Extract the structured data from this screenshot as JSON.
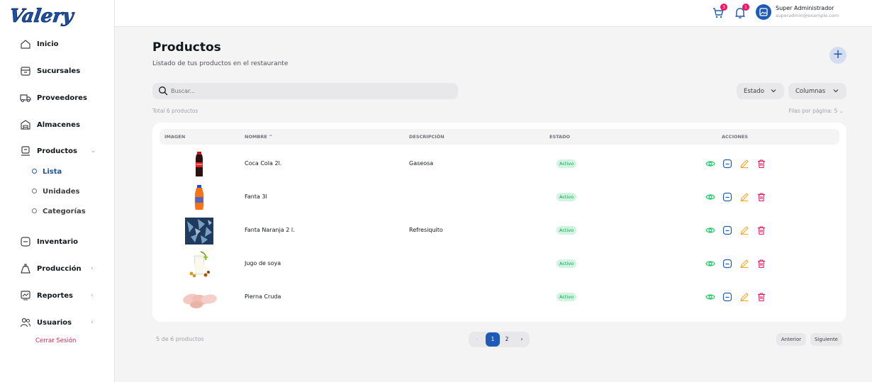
{
  "brand": {
    "logo_text": "Valery",
    "color": "#1e4fa0"
  },
  "sidebar": {
    "items": [
      {
        "label": "Inicio",
        "icon": "home-icon"
      },
      {
        "label": "Sucursales",
        "icon": "store-icon"
      },
      {
        "label": "Proveedores",
        "icon": "truck-icon"
      },
      {
        "label": "Almacenes",
        "icon": "warehouse-icon"
      },
      {
        "label": "Productos",
        "icon": "product-icon",
        "expanded": true
      },
      {
        "label": "Inventario",
        "icon": "inventory-icon"
      },
      {
        "label": "Producción",
        "icon": "production-icon"
      },
      {
        "label": "Reportes",
        "icon": "reports-icon"
      },
      {
        "label": "Usuarios",
        "icon": "users-icon"
      }
    ],
    "sub_items": [
      {
        "label": "Lista",
        "active": true
      },
      {
        "label": "Unidades",
        "active": false
      },
      {
        "label": "Categorías",
        "active": false
      }
    ],
    "logout_label": "Cerrar Sesión"
  },
  "topbar": {
    "cart_badge": "3",
    "bell_badge": "1",
    "user_name": "Super Administrador",
    "user_email": "superadmin@example.com"
  },
  "main": {
    "title": "Productos",
    "subtitle": "Listado de tus productos en el restaurante",
    "search_placeholder": "Buscar...",
    "estado_label": "Estado",
    "columnas_label": "Columnas",
    "total_label": "Total 6 productos",
    "rows_per_page_label": "Filas por página: 5"
  },
  "table": {
    "headers": {
      "imagen": "IMAGEN",
      "nombre": "NOMBRE",
      "descripcion": "DESCRIPCIÓN",
      "estado": "ESTADO",
      "acciones": "ACCIONES"
    },
    "rows": [
      {
        "nombre": "Coca Cola 2l.",
        "descripcion": "Gaseosa",
        "estado": "Activo",
        "image": "cola-bottle"
      },
      {
        "nombre": "Fanta 3l",
        "descripcion": "",
        "estado": "Activo",
        "image": "orange-soda-bottle"
      },
      {
        "nombre": "Fanta Naranja 2 l.",
        "descripcion": "Refresiquito",
        "estado": "Activo",
        "image": "blue-pattern-image"
      },
      {
        "nombre": "Jugo de soya",
        "descripcion": "",
        "estado": "Activo",
        "image": "soy-milk-glass"
      },
      {
        "nombre": "Pierna Cruda",
        "descripcion": "",
        "estado": "Activo",
        "image": "raw-chicken-legs"
      }
    ]
  },
  "pagination": {
    "count_label": "5 de 6 productos",
    "pages": [
      "1",
      "2"
    ],
    "current_page": "1",
    "prev_label": "Anterior",
    "next_label": "Siguiente"
  },
  "colors": {
    "accent": "#1e5ab6",
    "danger": "#f31260",
    "success": "#12a150",
    "view_icon": "#17c964",
    "edit_icon": "#f5a524"
  }
}
